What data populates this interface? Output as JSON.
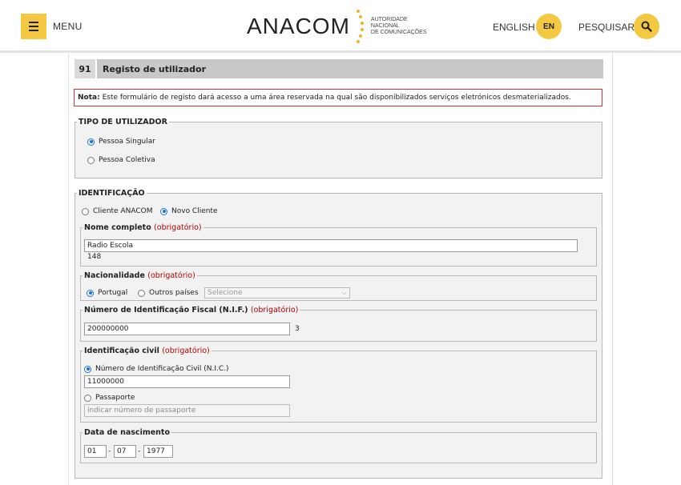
{
  "header": {
    "menu_label": "MENU",
    "logo_text": "ANACOM",
    "logo_sub": [
      "AUTORIDADE",
      "NACIONAL",
      "DE COMUNICAÇÕES"
    ],
    "lang_label": "ENGLISH",
    "lang_code": "EN",
    "search_label": "PESQUISAR",
    "accent_color": "#f5c842"
  },
  "form": {
    "number": "91",
    "title": "Registo de utilizador",
    "note_label": "Nota:",
    "note_text": " Este formulário de registo dará acesso a uma área reservada na qual são disponibilizados serviços eletrónicos desmaterializados.",
    "tipo": {
      "legend": "TIPO DE UTILIZADOR",
      "opt1": "Pessoa Singular",
      "opt2": "Pessoa Coletiva",
      "selected": "Pessoa Singular"
    },
    "identificacao": {
      "legend": "IDENTIFICAÇÃO",
      "opt1": "Cliente ANACOM",
      "opt2": "Novo Cliente",
      "selected": "Novo Cliente"
    },
    "required": "(obrigatório)",
    "nome": {
      "legend": "Nome completo",
      "value": "Radio Escola",
      "counter": "148"
    },
    "nacionalidade": {
      "legend": "Nacionalidade",
      "opt1": "Portugal",
      "opt2": "Outros países",
      "select_placeholder": "Selecione",
      "selected": "Portugal"
    },
    "nif": {
      "legend": "Número de Identificação Fiscal (N.I.F.)",
      "value": "200000000",
      "counter": "3"
    },
    "civil": {
      "legend": "Identificação civil",
      "opt1": "Número de Identificação Civil (N.I.C.)",
      "nic_value": "11000000",
      "opt2": "Passaporte",
      "passport_placeholder": "indicar número de passaporte",
      "selected": "Número de Identificação Civil (N.I.C.)"
    },
    "nascimento": {
      "legend": "Data de nascimento",
      "day": "01",
      "month": "07",
      "year": "1977",
      "sep": "-"
    }
  }
}
